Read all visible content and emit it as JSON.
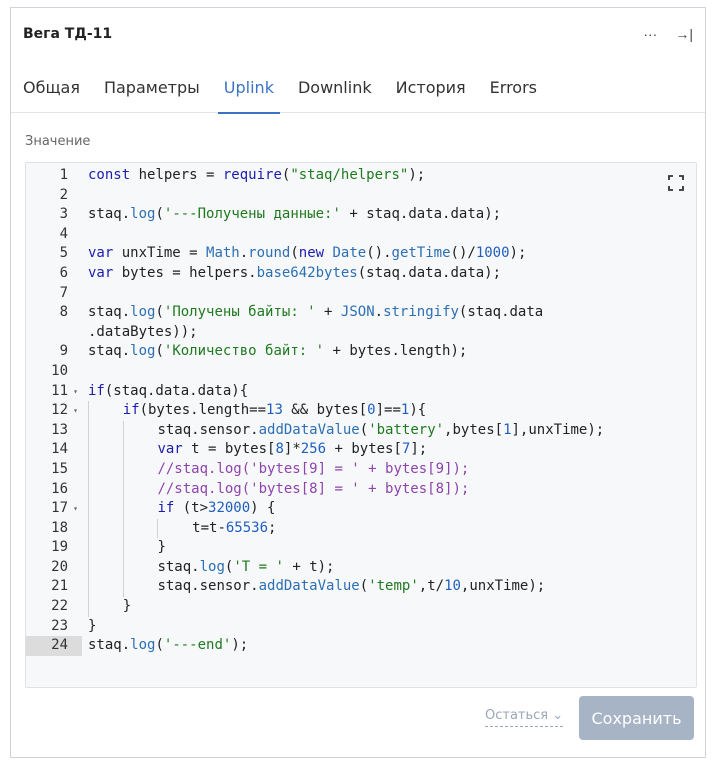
{
  "header": {
    "title": "Вега ТД-11",
    "more_label": "···",
    "collapse_label": "→|"
  },
  "tabs": [
    {
      "label": "Общая"
    },
    {
      "label": "Параметры"
    },
    {
      "label": "Uplink",
      "active": true
    },
    {
      "label": "Downlink"
    },
    {
      "label": "История"
    },
    {
      "label": "Errors"
    }
  ],
  "section_label": "Значение",
  "editor": {
    "active_line": 24,
    "lines": [
      "const helpers = require(\"staq/helpers\");",
      "",
      "staq.log('---Получены данные:' + staq.data.data);",
      "",
      "var unxTime = Math.round(new Date().getTime()/1000);",
      "var bytes = helpers.base642bytes(staq.data.data);",
      "",
      "staq.log('Получены байты: ' + JSON.stringify(staq.data",
      ".dataBytes));",
      "staq.log('Количество байт: ' + bytes.length);",
      "",
      "if(staq.data.data){",
      "    if(bytes.length==13 && bytes[0]==1){",
      "        staq.sensor.addDataValue('battery',bytes[1],unxTime);",
      "        var t = bytes[8]*256 + bytes[7];",
      "        //staq.log('bytes[9] = ' + bytes[9]);",
      "        //staq.log('bytes[8] = ' + bytes[8]);",
      "        if (t>32000) {",
      "            t=t-65536;",
      "        }",
      "        staq.log('T = ' + t);",
      "        staq.sensor.addDataValue('temp',t/10,unxTime);",
      "    }",
      "}",
      "staq.log('---end');"
    ],
    "line_numbers": [
      "1",
      "2",
      "3",
      "4",
      "5",
      "6",
      "7",
      "8",
      "",
      "9",
      "10",
      "11",
      "12",
      "13",
      "14",
      "15",
      "16",
      "17",
      "18",
      "19",
      "20",
      "21",
      "22",
      "23",
      "24"
    ],
    "fold_lines": [
      "11",
      "12",
      "17"
    ]
  },
  "footer": {
    "stay_label": "Остаться",
    "save_label": "Сохранить"
  }
}
